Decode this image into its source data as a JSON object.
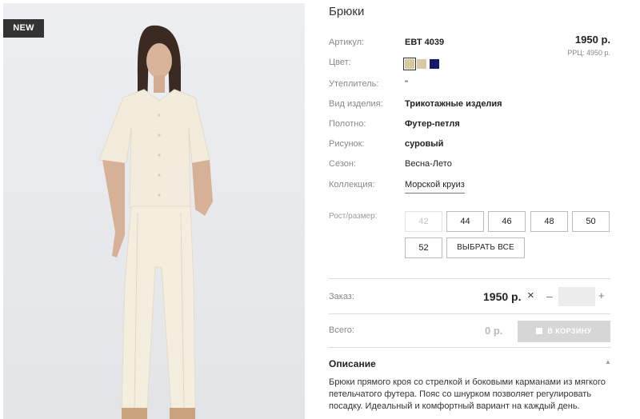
{
  "badge": "NEW",
  "product": {
    "title": "Брюки",
    "price": "1950 р.",
    "rrp": "РРЦ: 4950 р."
  },
  "attributes": [
    {
      "label": "Артикул:",
      "value": "ЕВТ 4039"
    },
    {
      "label": "Цвет:",
      "value": ""
    },
    {
      "label": "Утеплитель:",
      "value": "\""
    },
    {
      "label": "Вид изделия:",
      "value": "Трикотажные изделия"
    },
    {
      "label": "Полотно:",
      "value": "Футер-петля"
    },
    {
      "label": "Рисунок:",
      "value": "суровый"
    },
    {
      "label": "Сезон:",
      "value": "Весна-Лето"
    },
    {
      "label": "Коллекция:",
      "value": "Морской круиз"
    }
  ],
  "colors": [
    "#d9c89e",
    "#d6c9a8",
    "#101a6a"
  ],
  "sizes": {
    "label": "Рост/размер:",
    "options": [
      "42",
      "44",
      "46",
      "48",
      "50",
      "52"
    ],
    "select_all": "ВЫБРАТЬ ВСЕ"
  },
  "order": {
    "label": "Заказ:",
    "price": "1950 р.",
    "times": "×",
    "minus": "–",
    "plus": "+",
    "quantity": ""
  },
  "total": {
    "label": "Всего:",
    "value": "0 р.",
    "cart_button": "В КОРЗИНУ"
  },
  "description": {
    "title": "Описание",
    "caret": "▲",
    "text": "Брюки прямого кроя со стрелкой и боковыми карманами из мягкого петельчатого футера. Пояс со шнурком позволяет регулировать посадку. Идеальный и комфортный вариант на каждый день."
  }
}
